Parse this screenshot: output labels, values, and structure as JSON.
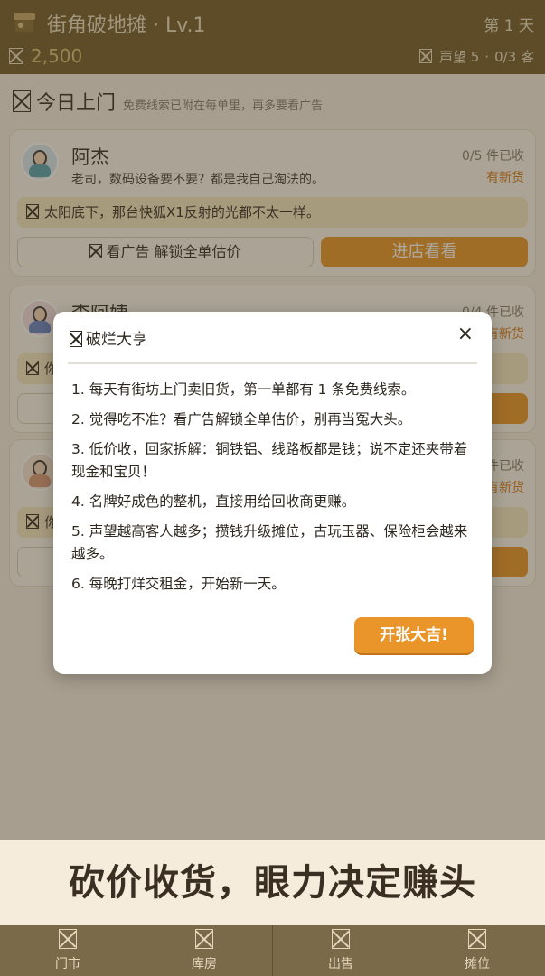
{
  "header": {
    "title": "街角破地摊 · Lv.1",
    "day": "第 1 天",
    "money": "2,500",
    "reputation": "声望 5",
    "customers": "0/3 客"
  },
  "section": {
    "title": "今日上门",
    "hint": "免费线索已附在每单里，再多要看广告"
  },
  "visitors": [
    {
      "name": "阿杰",
      "quote": "老司，数码设备要不要？都是我自己淘法的。",
      "count": "0/5 件已收",
      "badge": "有新货",
      "clue": "太阳底下，那台快狐X1反射的光都不太一样。",
      "ad_button": "看广告 解锁全单估价",
      "enter_button": "进店看看"
    },
    {
      "name": "李阿姨",
      "count": "0/4 件已收",
      "badge": "有新货",
      "clue_prefix": "你"
    },
    {
      "count": "件已收",
      "badge": "有新货",
      "clue_prefix": "你"
    }
  ],
  "modal": {
    "title": "破烂大亨",
    "close": "×",
    "rules": [
      "1. 每天有街坊上门卖旧货，第一单都有 1 条免费线索。",
      "2. 觉得吃不准？看广告解锁全单估价，别再当冤大头。",
      "3. 低价收，回家拆解：铜铁铝、线路板都是钱；说不定还夹带着现金和宝贝！",
      "4. 名牌好成色的整机，直接用给回收商更赚。",
      "5. 声望越高客人越多；攒钱升级摊位，古玩玉器、保险柜会越来越多。",
      "6. 每晚打烊交租金，开始新一天。"
    ],
    "start_button": "开张大吉!"
  },
  "banner": "砍价收货，眼力决定赚头",
  "nav": [
    "门市",
    "库房",
    "出售",
    "摊位"
  ]
}
